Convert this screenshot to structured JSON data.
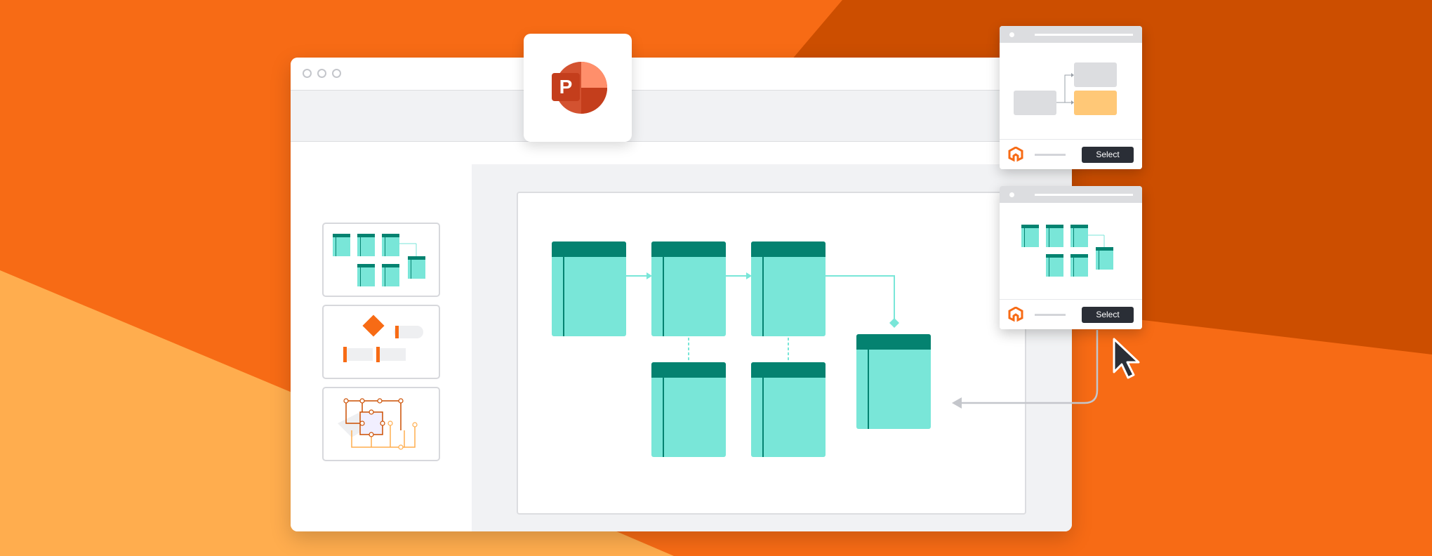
{
  "app": {
    "name": "PowerPoint",
    "logo_letter": "P"
  },
  "window": {
    "controls": [
      "close",
      "minimize",
      "maximize"
    ]
  },
  "sidebar": {
    "thumbnails": [
      {
        "name": "database-diagram-slide"
      },
      {
        "name": "flowchart-slide"
      },
      {
        "name": "network-diagram-slide"
      }
    ]
  },
  "template_cards": [
    {
      "name": "flowchart-template",
      "select_label": "Select"
    },
    {
      "name": "database-template",
      "select_label": "Select"
    }
  ],
  "colors": {
    "background_orange": "#f76b15",
    "background_dark_orange": "#cc4e00",
    "background_light_orange": "#ffad4e",
    "table_fill": "#79e6d8",
    "table_header": "#048270",
    "button_dark": "#2a2e36",
    "highlight_yellow": "#ffc877"
  }
}
